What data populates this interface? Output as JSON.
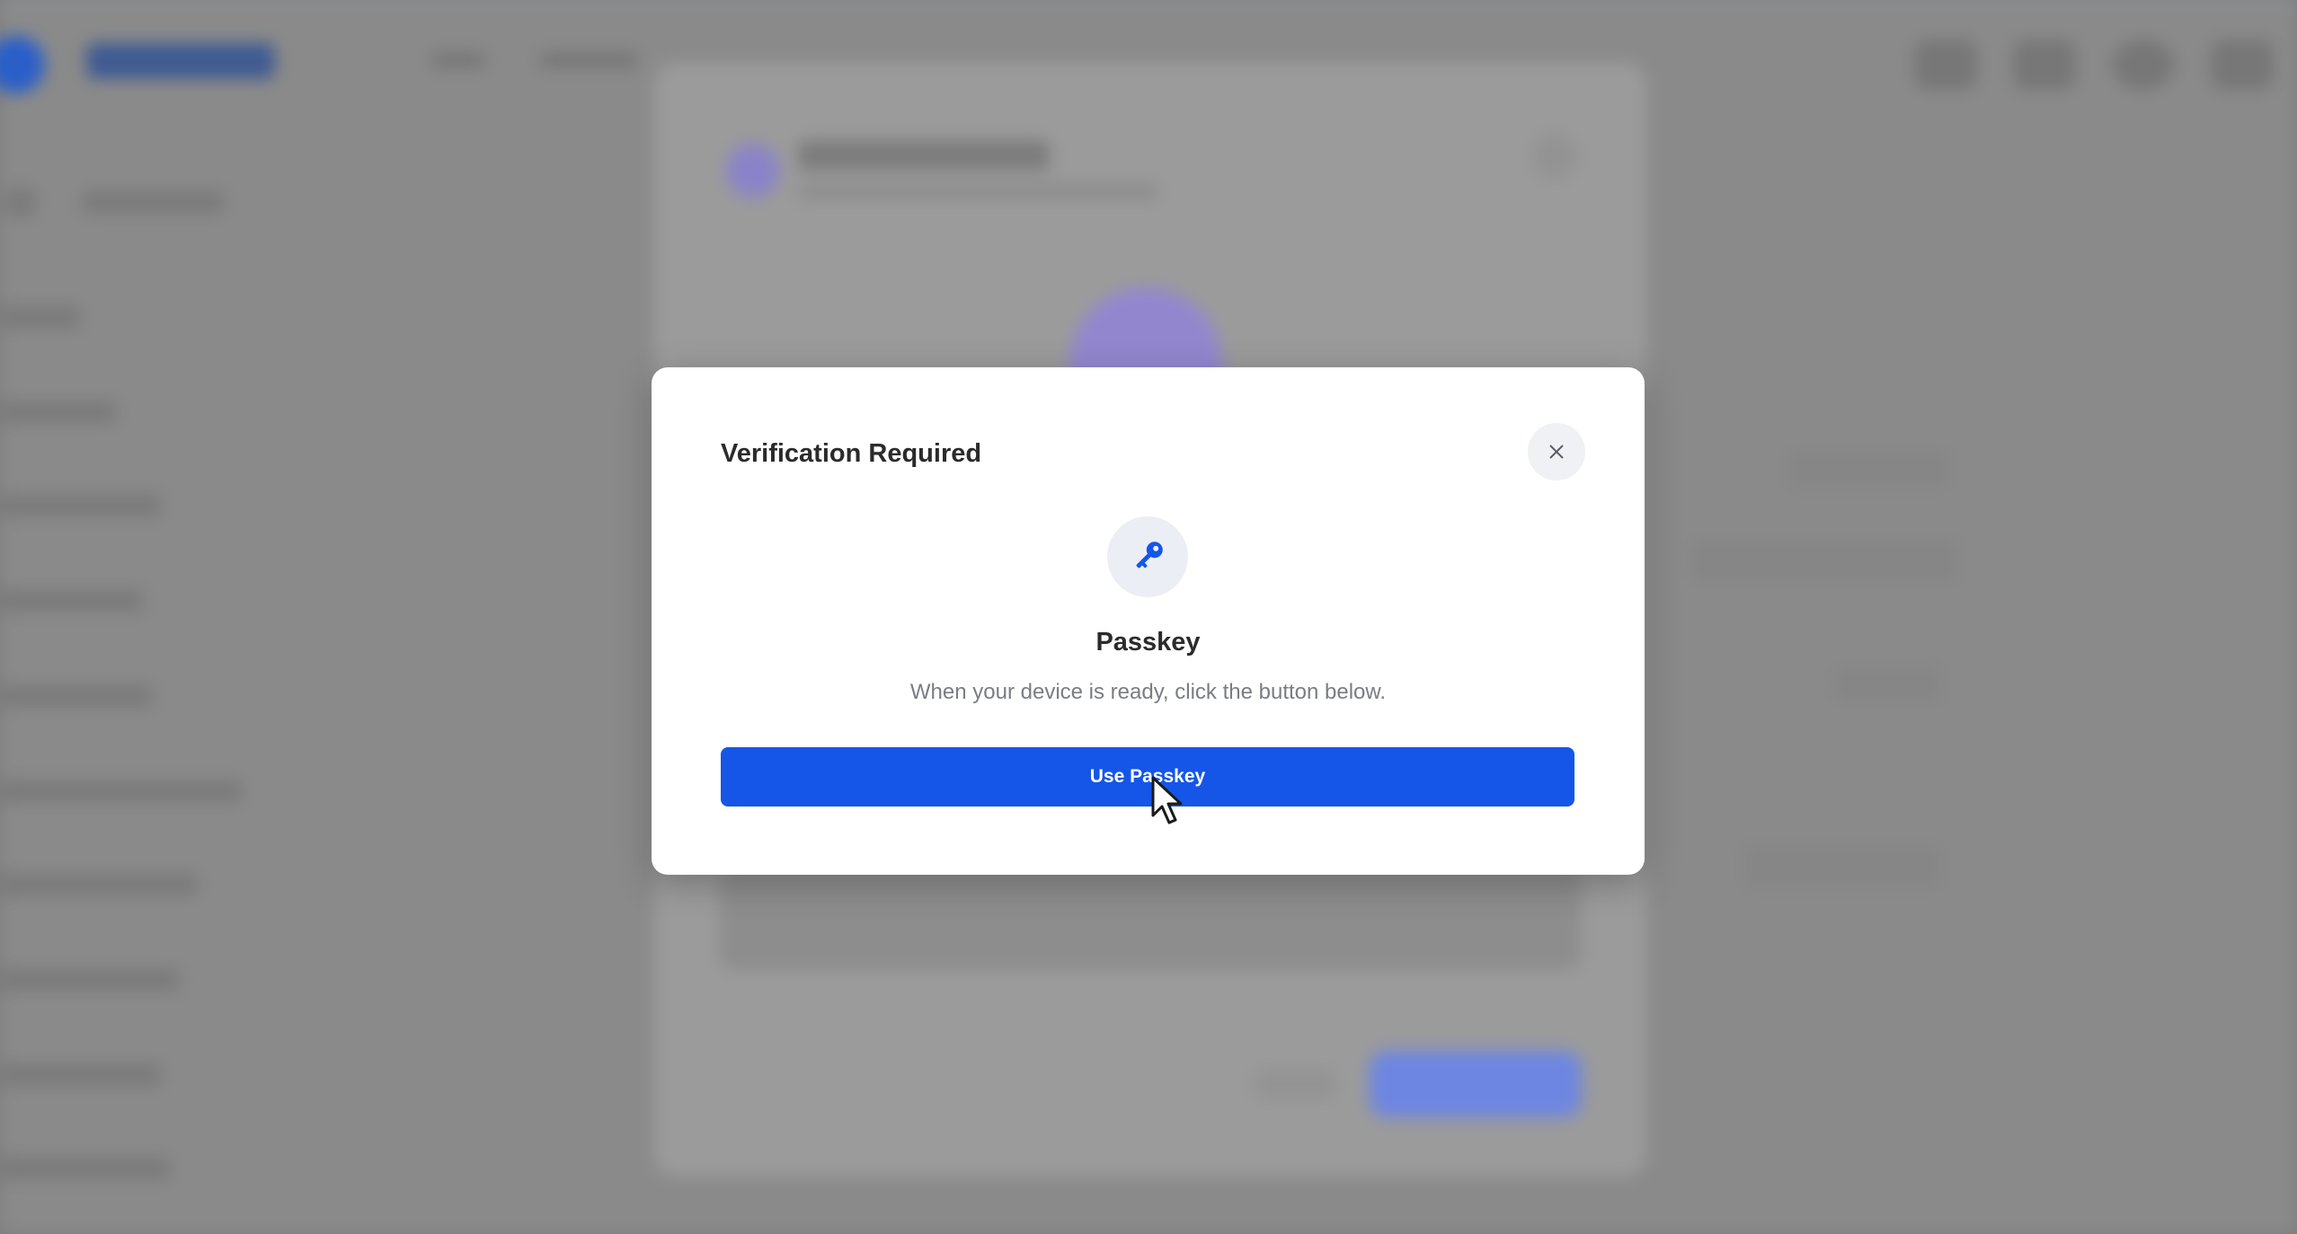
{
  "dialog": {
    "title": "Verification Required",
    "close_icon": "close-icon",
    "method_icon": "key-icon",
    "method_name": "Passkey",
    "description": "When your device is ready, click the button below.",
    "primary_button_label": "Use Passkey"
  },
  "colors": {
    "accent": "#1556e8",
    "overlay": "#7d7d7d",
    "icon_badge_bg": "#eceef6",
    "close_bg": "#f0f1f4"
  }
}
